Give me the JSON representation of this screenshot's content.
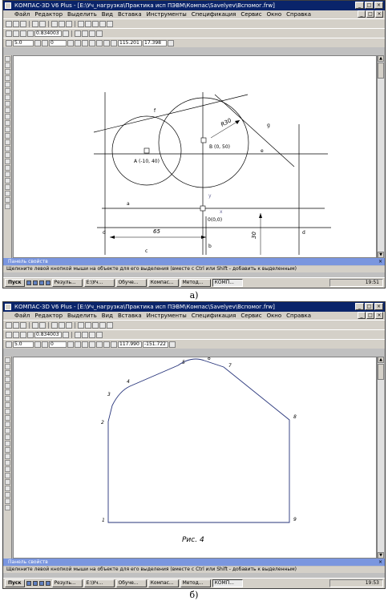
{
  "windows": [
    {
      "title": "КОМПАС-3D V6 Plus - [E:\\Уч_нагрузка\\Практика исп ПЭВМ\\Компас\\Savelyev\\Вспомог.frw]",
      "menu": [
        "Файл",
        "Редактор",
        "Выделить",
        "Вид",
        "Вставка",
        "Инструменты",
        "Спецификация",
        "Сервис",
        "Окно",
        "Справка"
      ],
      "zoom": "0.834003",
      "style_value": "5.0",
      "layer_value": "0",
      "coord_x": "115.201",
      "coord_y": "17.398",
      "property_panel": "Панель свойств",
      "status": "Щелкните левой кнопкой мыши на объекте для его выделения (вместе с Ctrl или Shift - добавить к выделенным)",
      "start": "Пуск",
      "tasks": [
        "Резуль...",
        "E:\\Уч...",
        "Обуче...",
        "Компас...",
        "Метод...",
        "КОМП..."
      ],
      "clock": "19:51",
      "drawing": {
        "labels": {
          "radius": "R30",
          "point_a": "A (-10, 40)",
          "point_b": "B (0, 50)",
          "origin": "0(0,0)",
          "dim_h": "65",
          "dim_v": "30",
          "y_axis": "y",
          "x_axis": "x",
          "tangent_top": "f",
          "line_g": "g",
          "line_e": "e",
          "line_a": "a",
          "line_c": "c",
          "line_b": "b",
          "line_d_left": "d",
          "line_d_right": "d"
        }
      },
      "caption": "а)"
    },
    {
      "title": "КОМПАС-3D V6 Plus - [E:\\Уч_нагрузка\\Практика исп ПЭВМ\\Компас\\Savelyev\\Вспомог.frw]",
      "menu": [
        "Файл",
        "Редактор",
        "Выделить",
        "Вид",
        "Вставка",
        "Инструменты",
        "Спецификация",
        "Сервис",
        "Окно",
        "Справка"
      ],
      "zoom": "0.834003",
      "style_value": "5.0",
      "layer_value": "0",
      "coord_x": "117.990",
      "coord_y": "-151.722",
      "property_panel": "Панель свойств",
      "status": "Щелкните левой кнопкой мыши на объекте для его выделения (вместе с Ctrl или Shift - добавить к выделенным)",
      "start": "Пуск",
      "tasks": [
        "Резуль...",
        "E:\\Уч...",
        "Обуче...",
        "Компас...",
        "Метод...",
        "КОМП..."
      ],
      "clock": "19:53",
      "drawing": {
        "points": [
          "1",
          "2",
          "3",
          "4",
          "5",
          "6",
          "7",
          "8",
          "9"
        ],
        "figure_label": "Рис. 4"
      },
      "caption": "б)"
    }
  ]
}
